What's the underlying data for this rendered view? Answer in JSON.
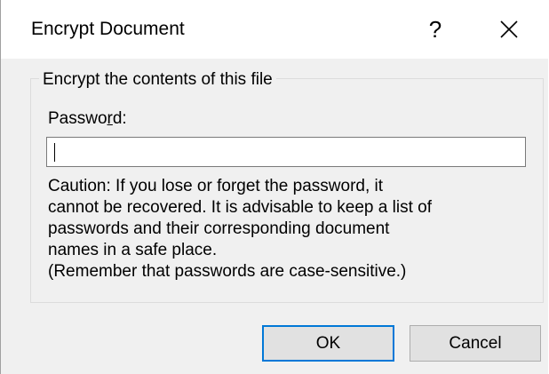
{
  "dialog": {
    "title": "Encrypt Document",
    "help_label": "?",
    "close_label": "✕"
  },
  "group": {
    "legend": "Encrypt the contents of this file",
    "password_label_pre": "Passwo",
    "password_label_accel": "r",
    "password_label_post": "d:",
    "password_value": "",
    "caution_lines": [
      "Caution: If you lose or forget the password, it",
      "cannot be recovered. It is advisable to keep a list of",
      "passwords and their corresponding document",
      "names in a safe place.",
      "(Remember that passwords are case-sensitive.)"
    ]
  },
  "buttons": {
    "ok_label": "OK",
    "cancel_label": "Cancel"
  },
  "colors": {
    "default_button_border": "#0078d7",
    "dialog_background": "#f0f0f0"
  }
}
